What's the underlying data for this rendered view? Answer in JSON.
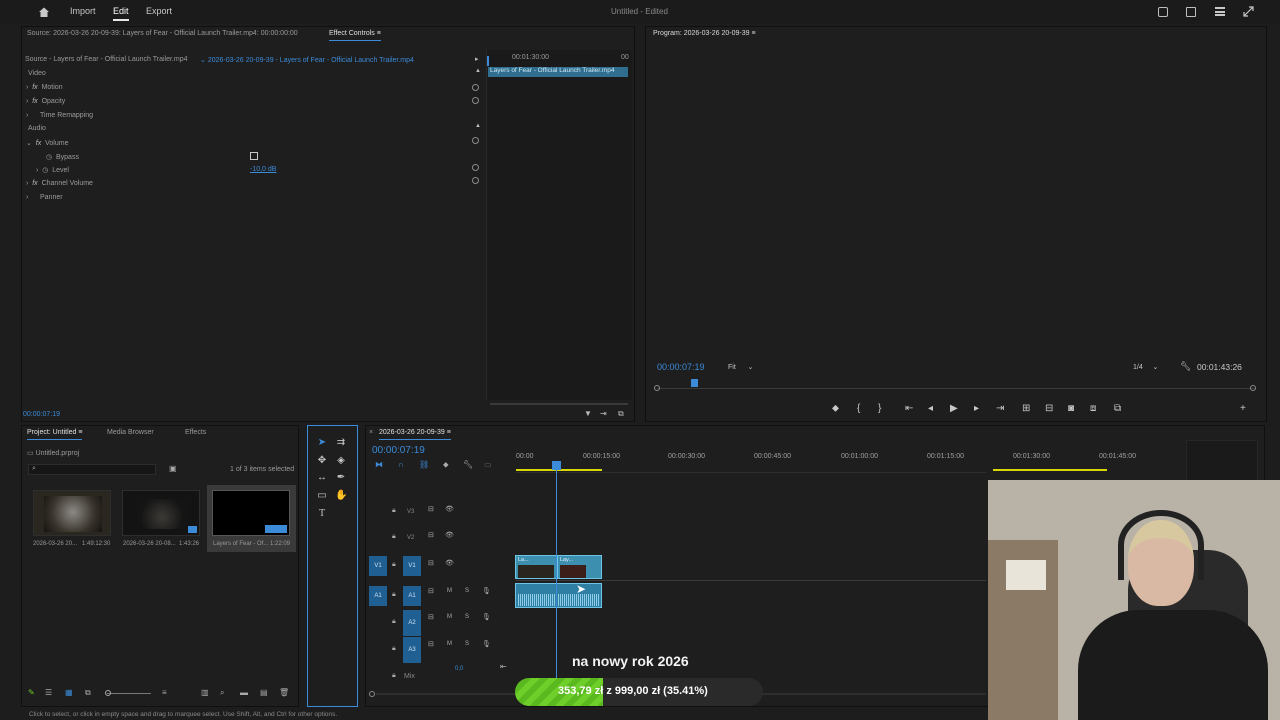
{
  "topbar": {
    "tabs": [
      "Import",
      "Edit",
      "Export"
    ],
    "title": "Untitled",
    "title_status": "- Edited"
  },
  "source_panel": {
    "tab_source": "Source: 2026-03-26 20-09-39: Layers of Fear - Official Launch Trailer.mp4: 00:00:00:00",
    "tab_effect_controls": "Effect Controls",
    "master_clip": "Source - Layers of Fear - Official Launch Trailer.mp4",
    "sequence_clip": "2026-03-26 20-09-39 - Layers of Fear - Official Launch Trailer.mp4",
    "section_video": "Video",
    "fx": [
      "Motion",
      "Opacity",
      "Time Remapping"
    ],
    "section_audio": "Audio",
    "volume": "Volume",
    "bypass": "Bypass",
    "level": "Level",
    "level_value": "-10,0 dB",
    "channel_volume": "Channel Volume",
    "panner": "Panner",
    "mini_timecode": "00:01:30:00",
    "mini_end": "00",
    "mini_clip": "Layers of Fear - Official Launch Trailer.mp4",
    "timecode": "00:00:07:19"
  },
  "program_monitor": {
    "tab": "Program: 2026-03-26 20-09-39",
    "timecode": "00:00:07:19",
    "fit": "Fit",
    "resolution": "1/4",
    "duration": "00:01:43:26"
  },
  "project_panel": {
    "tabs": [
      "Project: Untitled",
      "Media Browser",
      "Effects"
    ],
    "file": "Untitled.prproj",
    "selected_count": "1 of 3 items selected",
    "items": [
      {
        "name": "2026-03-26 20...",
        "duration": "1:49:12:30"
      },
      {
        "name": "2026-03-26 20-08...",
        "duration": "1:43:26"
      },
      {
        "name": "Layers of Fear - Of...",
        "duration": "1:22:09"
      }
    ]
  },
  "timeline": {
    "tab": "2026-03-26 20-09-39",
    "timecode": "00:00:07:19",
    "ruler": [
      "00:00",
      "00:00:15:00",
      "00:00:30:00",
      "00:00:45:00",
      "00:01:00:00",
      "00:01:15:00",
      "00:01:30:00",
      "00:01:45:00"
    ],
    "tracks_video": [
      "V3",
      "V2",
      "V1"
    ],
    "tracks_audio": [
      "A1",
      "A2",
      "A3"
    ],
    "mix_label": "Mix",
    "mix_value": "0,0",
    "clip_v1a": "La...",
    "clip_v1b": "Lay..."
  },
  "statusbar": {
    "hint": "Click to select, or click in empty space and drag to marquee select. Use Shift, Alt, and Ctrl for other options."
  },
  "overlay": {
    "caption": "na nowy rok 2026",
    "donation_progress": "353,79 zł z 999,00 zł (35.41%)",
    "progress_fraction": 0.3541,
    "progress_color": "#6fcf2a"
  }
}
